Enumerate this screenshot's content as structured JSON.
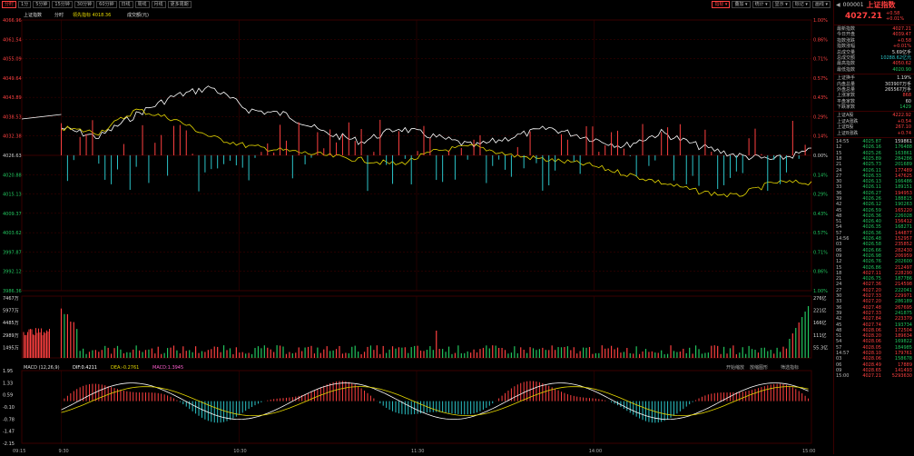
{
  "toolbar": {
    "buttons": [
      "分时",
      "1分",
      "5分钟",
      "15分钟",
      "30分钟",
      "60分钟",
      "日线",
      "周线",
      "月线",
      "更多周期"
    ],
    "right_buttons": [
      "指标",
      "叠加",
      "统计",
      "显示",
      "标记",
      "画线"
    ]
  },
  "header": {
    "label": "上证指数",
    "sub": "分时",
    "lead_label": "领先指标",
    "lead_value": "4018.36",
    "volume_label": "成交额(元)"
  },
  "axes": {
    "price_left": [
      "4066.96",
      "4061.54",
      "4055.09",
      "4049.64",
      "4043.89",
      "4038.53",
      "4032.38",
      "4026.63",
      "4020.88",
      "4015.13",
      "4009.37",
      "4003.62",
      "3997.87",
      "3992.12",
      "3986.36"
    ],
    "pct_right": [
      "1.00%",
      "0.86%",
      "0.71%",
      "0.57%",
      "0.43%",
      "0.29%",
      "0.14%",
      "0.00%",
      "0.14%",
      "0.29%",
      "0.43%",
      "0.57%",
      "0.71%",
      "0.86%",
      "1.00%"
    ],
    "vol_left": [
      "7467万",
      "5977万",
      "4485万",
      "2989万",
      "1495万"
    ],
    "vol_right": [
      "276亿",
      "221亿",
      "166亿",
      "111亿",
      "55.3亿"
    ],
    "macd_left": [
      "1.95",
      "1.33",
      "0.59",
      "-0.10",
      "-0.78",
      "-1.47",
      "-2.15"
    ],
    "time_labels": [
      "09:15",
      "9:30",
      "10:30",
      "11:30",
      "14:00",
      "15:00"
    ]
  },
  "macd": {
    "label": "MACD",
    "params": "(12,26,9)",
    "dif": "DIF:0.4211",
    "dea": "DEA:-0.2761",
    "macd": "MACD:1.3945",
    "btn_left": "开始缩放",
    "btn_mid": "放缩图形",
    "btn_right": "筛选指标"
  },
  "panel": {
    "code": "000001",
    "name": "上证指数",
    "price": "4027.21",
    "change": "+0.58",
    "change_pct": "+0.01%",
    "stats": [
      {
        "label": "最新指数",
        "value": "4027.21",
        "color": "red"
      },
      {
        "label": "今日开盘",
        "value": "4039.47",
        "color": "red"
      },
      {
        "label": "指数涨跌",
        "value": "+0.58",
        "color": "red"
      },
      {
        "label": "指数涨幅",
        "value": "+0.01%",
        "color": "red"
      },
      {
        "label": "总成交量",
        "value": "5.69亿手",
        "color": "white"
      },
      {
        "label": "总成交额",
        "value": "10288.62亿元",
        "color": "cyan"
      },
      {
        "label": "最高指数",
        "value": "4050.62",
        "color": "red"
      },
      {
        "label": "最低指数",
        "value": "4020.90",
        "color": "green"
      }
    ],
    "stats2": [
      {
        "label": "上证换手",
        "value": "1.19%",
        "color": "white"
      },
      {
        "label": "内盘总量",
        "value": "303907万手",
        "color": "white"
      },
      {
        "label": "外盘总量",
        "value": "265567万手",
        "color": "white"
      },
      {
        "label": "上涨家数",
        "value": "868",
        "color": "red"
      },
      {
        "label": "平盘家数",
        "value": "60",
        "color": "white"
      },
      {
        "label": "下跌家数",
        "value": "1429",
        "color": "green"
      }
    ],
    "stats3": [
      {
        "label": "上证A股",
        "value": "4222.92",
        "color": "red"
      },
      {
        "label": "上证A涨跌",
        "value": "+0.54",
        "color": "red"
      },
      {
        "label": "上证B股",
        "value": "267.10",
        "color": "red"
      },
      {
        "label": "上证B涨跌",
        "value": "+0.74",
        "color": "red"
      }
    ],
    "trades": [
      {
        "t": "14:55",
        "p": "4025.87",
        "v": "159861",
        "pc": "green",
        "vc": "white"
      },
      {
        "t": "12",
        "p": "4026.16",
        "v": "176488",
        "pc": "green",
        "vc": "green"
      },
      {
        "t": "15",
        "p": "4025.26",
        "v": "163861",
        "pc": "green",
        "vc": "green"
      },
      {
        "t": "18",
        "p": "4025.89",
        "v": "284286",
        "pc": "green",
        "vc": "green"
      },
      {
        "t": "21",
        "p": "4025.73",
        "v": "201689",
        "pc": "green",
        "vc": "green"
      },
      {
        "t": "24",
        "p": "4026.11",
        "v": "177489",
        "pc": "green",
        "vc": "red"
      },
      {
        "t": "27",
        "p": "4026.33",
        "v": "147625",
        "pc": "green",
        "vc": "red"
      },
      {
        "t": "30",
        "p": "4026.13",
        "v": "166486",
        "pc": "green",
        "vc": "green"
      },
      {
        "t": "33",
        "p": "4026.11",
        "v": "189151",
        "pc": "green",
        "vc": "green"
      },
      {
        "t": "36",
        "p": "4026.27",
        "v": "194953",
        "pc": "green",
        "vc": "red"
      },
      {
        "t": "39",
        "p": "4026.26",
        "v": "188815",
        "pc": "green",
        "vc": "green"
      },
      {
        "t": "42",
        "p": "4026.12",
        "v": "190263",
        "pc": "green",
        "vc": "green"
      },
      {
        "t": "45",
        "p": "4026.59",
        "v": "165220",
        "pc": "green",
        "vc": "red"
      },
      {
        "t": "48",
        "p": "4026.36",
        "v": "226028",
        "pc": "green",
        "vc": "green"
      },
      {
        "t": "51",
        "p": "4026.40",
        "v": "156412",
        "pc": "green",
        "vc": "red"
      },
      {
        "t": "54",
        "p": "4026.35",
        "v": "168271",
        "pc": "green",
        "vc": "green"
      },
      {
        "t": "57",
        "p": "4026.36",
        "v": "144877",
        "pc": "green",
        "vc": "red"
      },
      {
        "t": "14:56",
        "p": "4026.48",
        "v": "152957",
        "pc": "green",
        "vc": "red"
      },
      {
        "t": "03",
        "p": "4026.58",
        "v": "235852",
        "pc": "green",
        "vc": "red"
      },
      {
        "t": "06",
        "p": "4026.66",
        "v": "282430",
        "pc": "green",
        "vc": "red"
      },
      {
        "t": "09",
        "p": "4026.98",
        "v": "206959",
        "pc": "green",
        "vc": "red"
      },
      {
        "t": "12",
        "p": "4026.76",
        "v": "202600",
        "pc": "green",
        "vc": "green"
      },
      {
        "t": "15",
        "p": "4026.86",
        "v": "212497",
        "pc": "green",
        "vc": "red"
      },
      {
        "t": "18",
        "p": "4027.11",
        "v": "228290",
        "pc": "red",
        "vc": "red"
      },
      {
        "t": "21",
        "p": "4026.75",
        "v": "187786",
        "pc": "green",
        "vc": "green"
      },
      {
        "t": "24",
        "p": "4027.36",
        "v": "214598",
        "pc": "red",
        "vc": "red"
      },
      {
        "t": "27",
        "p": "4027.20",
        "v": "222041",
        "pc": "red",
        "vc": "green"
      },
      {
        "t": "30",
        "p": "4027.33",
        "v": "229971",
        "pc": "red",
        "vc": "red"
      },
      {
        "t": "33",
        "p": "4027.20",
        "v": "286189",
        "pc": "red",
        "vc": "green"
      },
      {
        "t": "36",
        "p": "4027.48",
        "v": "267695",
        "pc": "red",
        "vc": "red"
      },
      {
        "t": "39",
        "p": "4027.33",
        "v": "241875",
        "pc": "red",
        "vc": "green"
      },
      {
        "t": "42",
        "p": "4027.84",
        "v": "223379",
        "pc": "red",
        "vc": "red"
      },
      {
        "t": "45",
        "p": "4027.74",
        "v": "193734",
        "pc": "red",
        "vc": "green"
      },
      {
        "t": "48",
        "p": "4028.06",
        "v": "172504",
        "pc": "red",
        "vc": "red"
      },
      {
        "t": "51",
        "p": "4028.20",
        "v": "189634",
        "pc": "red",
        "vc": "red"
      },
      {
        "t": "54",
        "p": "4028.06",
        "v": "169822",
        "pc": "red",
        "vc": "green"
      },
      {
        "t": "57",
        "p": "4028.05",
        "v": "184985",
        "pc": "red",
        "vc": "green"
      },
      {
        "t": "14:57",
        "p": "4028.10",
        "v": "179761",
        "pc": "red",
        "vc": "red"
      },
      {
        "t": "03",
        "p": "4028.06",
        "v": "158678",
        "pc": "red",
        "vc": "green"
      },
      {
        "t": "06",
        "p": "4028.49",
        "v": "17889",
        "pc": "red",
        "vc": "red"
      },
      {
        "t": "09",
        "p": "4028.65",
        "v": "141493",
        "pc": "red",
        "vc": "red"
      },
      {
        "t": "15:00",
        "p": "4027.21",
        "v": "5293630",
        "pc": "red",
        "vc": "red"
      }
    ]
  },
  "colors": {
    "up": "#ff4040",
    "down": "#22c55e",
    "price_line": "#ffffff",
    "avg_line": "#e6d800",
    "cyan_bar": "#2bc4c8",
    "grid": "#3a0000"
  }
}
